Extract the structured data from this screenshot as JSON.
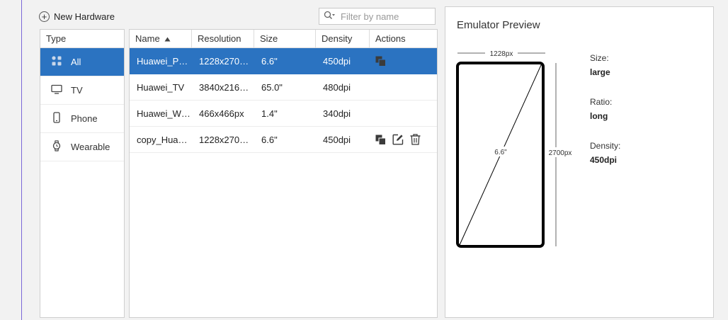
{
  "toolbar": {
    "new_hardware_label": "New Hardware",
    "filter_placeholder": "Filter by name"
  },
  "type_panel": {
    "header": "Type",
    "items": [
      {
        "label": "All",
        "icon": "grid-icon",
        "selected": true
      },
      {
        "label": "TV",
        "icon": "tv-icon",
        "selected": false
      },
      {
        "label": "Phone",
        "icon": "phone-icon",
        "selected": false
      },
      {
        "label": "Wearable",
        "icon": "watch-icon",
        "selected": false
      }
    ]
  },
  "table": {
    "columns": [
      "Name",
      "Resolution",
      "Size",
      "Density",
      "Actions"
    ],
    "sort": {
      "column": "Name",
      "direction": "ascending"
    },
    "rows": [
      {
        "name": "Huawei_P…",
        "resolution": "1228x270…",
        "size": "6.6\"",
        "density": "450dpi",
        "actions": [
          "copy"
        ],
        "selected": true
      },
      {
        "name": "Huawei_TV",
        "resolution": "3840x216…",
        "size": "65.0\"",
        "density": "480dpi",
        "actions": [],
        "selected": false
      },
      {
        "name": "Huawei_W…",
        "resolution": "466x466px",
        "size": "1.4\"",
        "density": "340dpi",
        "actions": [],
        "selected": false
      },
      {
        "name": "copy_Hua…",
        "resolution": "1228x270…",
        "size": "6.6\"",
        "density": "450dpi",
        "actions": [
          "copy",
          "edit",
          "delete"
        ],
        "selected": false
      }
    ]
  },
  "preview": {
    "title": "Emulator Preview",
    "width_label": "1228px",
    "height_label": "2700px",
    "diagonal_label": "6.6\"",
    "specs": [
      {
        "label": "Size:",
        "value": "large"
      },
      {
        "label": "Ratio:",
        "value": "long"
      },
      {
        "label": "Density:",
        "value": "450dpi"
      }
    ]
  },
  "colors": {
    "selection": "#2b73c1",
    "accent_border": "#7b68d8"
  }
}
